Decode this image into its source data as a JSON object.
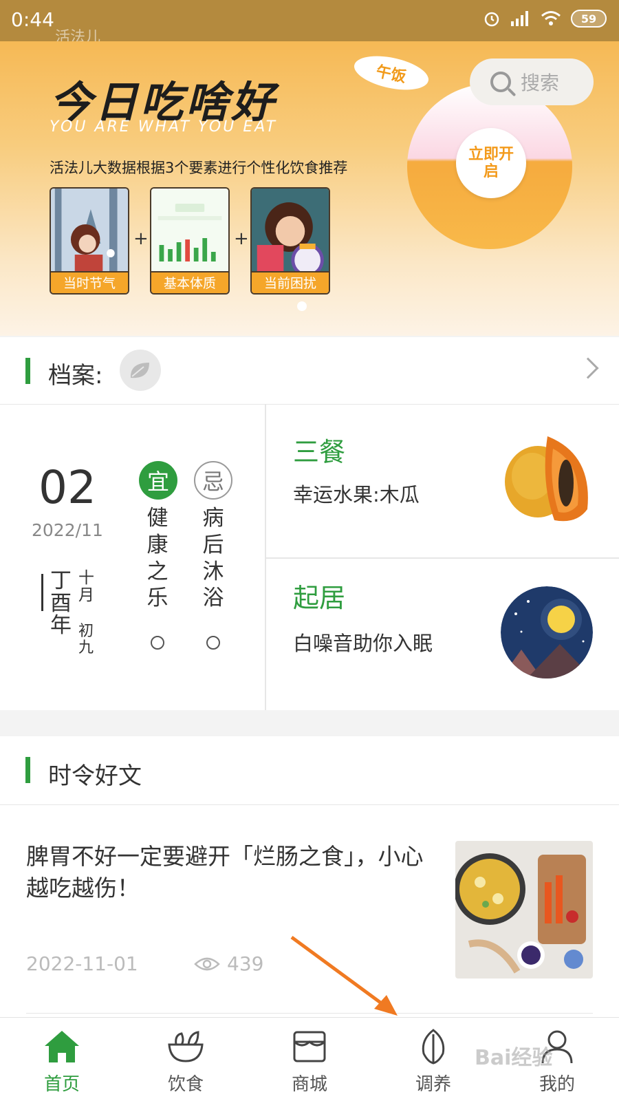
{
  "status_bar": {
    "time": "0:44",
    "battery": "59",
    "app_watermark": "活法儿"
  },
  "banner": {
    "title": "今日吃啥好",
    "subtitle": "YOU ARE WHAT YOU EAT",
    "description": "活法儿大数据根据3个要素进行个性化饮食推荐",
    "meal_tag": "午饭",
    "search_label": "搜索",
    "start_label": "立即开启",
    "factors": [
      {
        "label": "当时节气"
      },
      {
        "label": "基本体质"
      },
      {
        "label": "当前困扰"
      }
    ],
    "plus": "+"
  },
  "profile": {
    "label": "档案:"
  },
  "almanac": {
    "day": "02",
    "year_month": "2022/11",
    "lunar_year": "丁酉年",
    "lunar_month": "十月",
    "lunar_day": "初九",
    "yi": "宜",
    "ji": "忌",
    "yi_text": "健康之乐",
    "ji_text": "病后沐浴"
  },
  "tiles": {
    "meals": {
      "title": "三餐",
      "subtitle": "幸运水果:木瓜"
    },
    "routine": {
      "title": "起居",
      "subtitle": "白噪音助你入眠"
    }
  },
  "articles": {
    "section_title": "时令好文",
    "items": [
      {
        "headline": "脾胃不好一定要避开「烂肠之食」，小心越吃越伤！",
        "date": "2022-11-01",
        "views": "439"
      }
    ]
  },
  "bottom_nav": [
    {
      "label": "首页",
      "icon": "home-icon",
      "active": true
    },
    {
      "label": "饮食",
      "icon": "bowl-icon",
      "active": false
    },
    {
      "label": "商城",
      "icon": "shop-icon",
      "active": false
    },
    {
      "label": "调养",
      "icon": "leaf-icon",
      "active": false
    },
    {
      "label": "我的",
      "icon": "user-icon",
      "active": false
    }
  ],
  "watermark": "Bai经验",
  "colors": {
    "accent_green": "#2f9d3f",
    "banner_orange": "#f6b955",
    "status_bar": "#b48a3e"
  }
}
